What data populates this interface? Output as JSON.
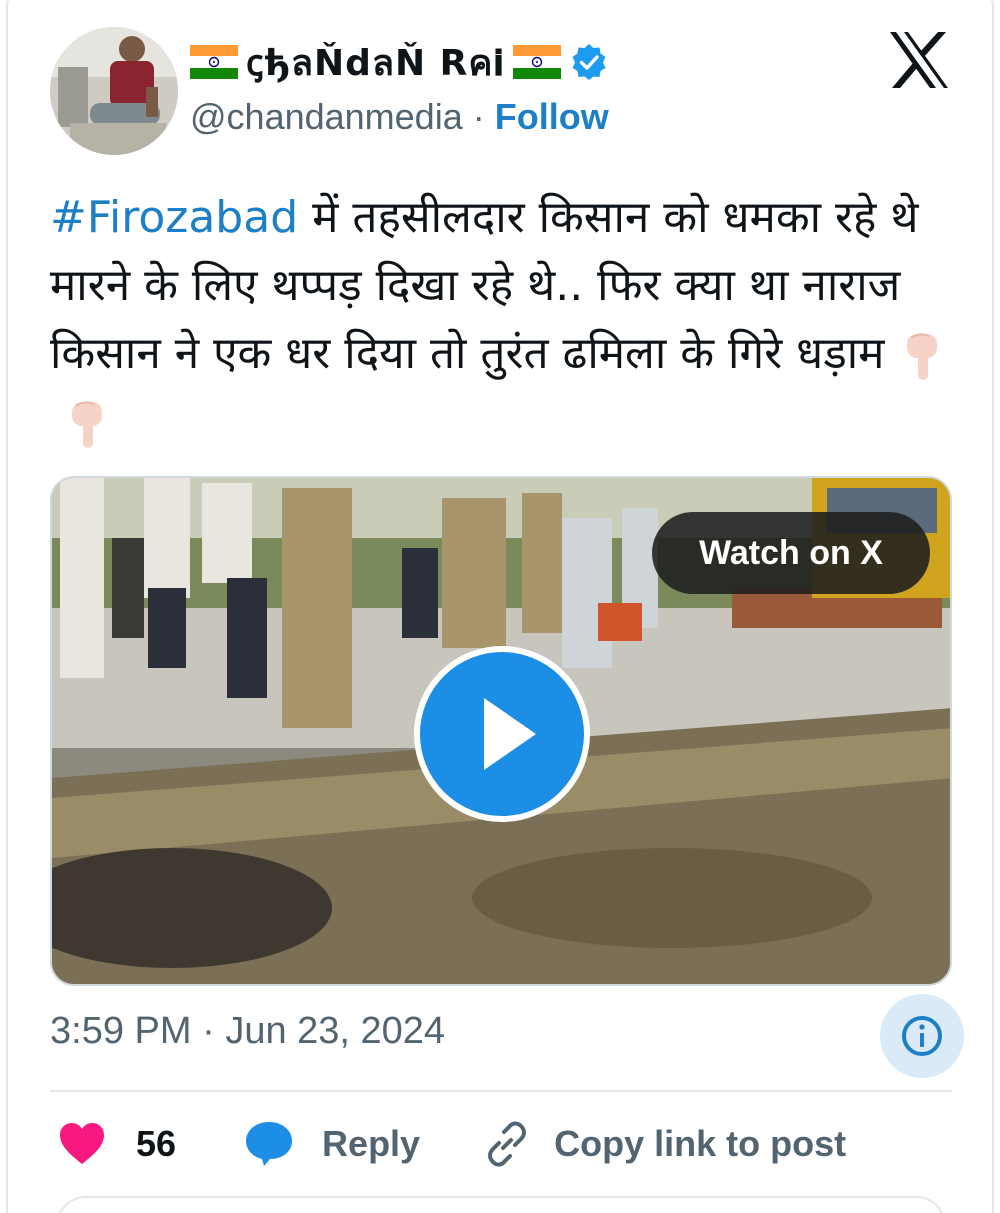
{
  "author": {
    "display_name": "ꞔђลŇdลŇ Rค𝐢",
    "handle": "@chandanmedia",
    "separator": "·",
    "follow_label": "Follow",
    "verified": true,
    "flag_icon": "india-flag-icon"
  },
  "post": {
    "hashtag": "#Firozabad",
    "text": " में तहसीलदार किसान को धमका रहे थे मारने के लिए थप्पड़ दिखा रहे थे.. फिर क्या था नाराज किसान ने एक धर दिया तो तुरंत ढमिला के गिरे धड़ाम",
    "emojis": [
      "pointing-down-emoji",
      "pointing-down-emoji"
    ]
  },
  "media": {
    "watch_label": "Watch on X",
    "play_icon": "play-icon"
  },
  "meta": {
    "time": "3:59 PM",
    "separator": "·",
    "date": "Jun 23, 2024"
  },
  "actions": {
    "like_count": "56",
    "reply_label": "Reply",
    "copy_label": "Copy link to post"
  },
  "colors": {
    "accent": "#1d7fc5",
    "like": "#f91880",
    "play": "#1d8ee6",
    "muted": "#536471"
  }
}
